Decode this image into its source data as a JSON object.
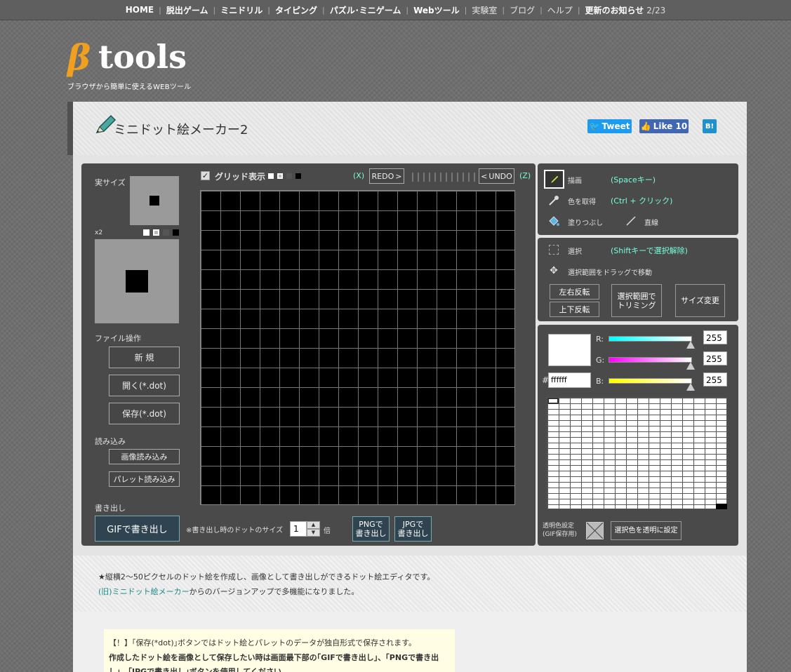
{
  "nav": {
    "items": [
      "HOME",
      "脱出ゲーム",
      "ミニドリル",
      "タイピング",
      "パズル･ミニゲーム",
      "Webツール",
      "実験室",
      "ブログ",
      "ヘルプ"
    ],
    "news_label": "更新のお知らせ",
    "news_date": "2/23"
  },
  "logo": {
    "beta": "β",
    "name": "tools",
    "tagline": "ブラウザから簡単に使えるWEBツール"
  },
  "header": {
    "title": "ミニドット絵メーカー2",
    "tweet": "Tweet",
    "like": "Like 10",
    "hatena": "B!"
  },
  "left": {
    "actual_size": "実サイズ",
    "x2": "x2",
    "file_ops": "ファイル操作",
    "new": "新 規",
    "open": "開く(*.dot)",
    "save": "保存(*.dot)",
    "load": "読み込み",
    "load_image": "画像読み込み",
    "load_palette": "パレット読み込み",
    "export": "書き出し",
    "gif": "GIFで書き出し"
  },
  "canvas": {
    "grid_label": "グリッド表示",
    "redo_key": "(X)",
    "redo": "REDO",
    "undo": "UNDO",
    "undo_key": "(Z)"
  },
  "export": {
    "size_label": "※書き出し時のドットのサイズ",
    "size": "1",
    "times": "倍",
    "png": "PNGで",
    "jpg": "JPGで",
    "out": "書き出し"
  },
  "tools": {
    "draw": "描画",
    "draw_key": "(Spaceキー)",
    "pick": "色を取得",
    "pick_key": "(Ctrl + クリック)",
    "fill": "塗りつぶし",
    "line": "直線"
  },
  "select": {
    "select": "選択",
    "select_key": "(Shiftキーで選択解除)",
    "move": "選択範囲をドラッグで移動",
    "flip_h": "左右反転",
    "flip_v": "上下反転",
    "trim_1": "選択範囲で",
    "trim_2": "トリミング",
    "resize": "サイズ変更"
  },
  "color": {
    "r_label": "R:",
    "g_label": "G:",
    "b_label": "B:",
    "r": "255",
    "g": "255",
    "b": "255",
    "hash": "#",
    "hex": "ffffff",
    "transparent_1": "透明色設定",
    "transparent_2": "(GIF保存用)",
    "set_transparent": "選択色を透明に設定",
    "current": "#ffffff"
  },
  "description": {
    "line1": "★縦横2～50ピクセルのドット絵を作成し、画像として書き出しができるドット絵エディタです。",
    "link": "(旧)ミニドット絵メーカー",
    "line2_rest": "からのバージョンアップで多機能になりました。"
  },
  "notice": {
    "line1": "【！】｢保存(*dot)｣ボタンではドット絵とパレットのデータが独自形式で保存されます。",
    "line2": "作成したドット絵を画像として保存したい時は画面最下部の｢GIFで書き出し｣、｢PNGで書き出",
    "line3": "し｣、｢JPGで書き出し｣ボタンを使用してください。"
  }
}
